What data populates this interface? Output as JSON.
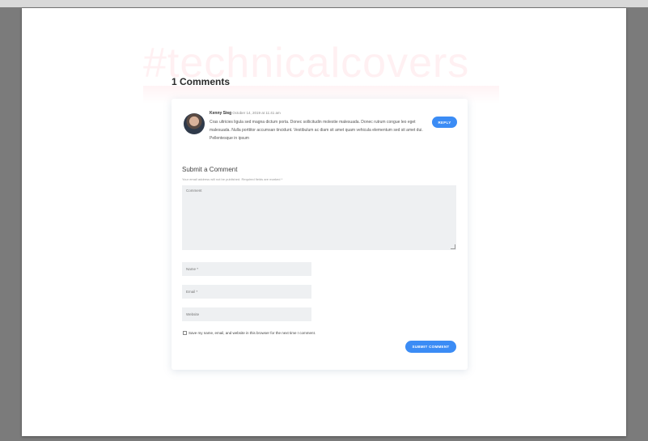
{
  "watermark": "#technicalcovers",
  "comments": {
    "heading": "1 Comments",
    "items": [
      {
        "author": "Kenny Sieg",
        "meta": "on October 14, 2019 at 11:41 am",
        "text": "Cras ultricies ligula sed magna dictum porta. Donec sollicitudin molestie malesuada. Donec rutrum congue leo eget malesuada. Nulla porttitor accumsan tincidunt. Vestibulum ac diam sit amet quam vehicula elementum sed sit amet dui. Pellentesque in ipsum",
        "reply_label": "REPLY"
      }
    ]
  },
  "form": {
    "title": "Submit a Comment",
    "notes": "Your email address will not be published. Required fields are marked *",
    "comment_placeholder": "Comment",
    "name_placeholder": "Name *",
    "email_placeholder": "Email *",
    "website_placeholder": "Website",
    "save_label": "Save my name, email, and website in this browser for the next time I comment.",
    "submit_label": "SUBMIT COMMENT"
  },
  "colors": {
    "accent": "#3b8cf5",
    "field_bg": "#eef0f2",
    "watermark": "#fff0f2"
  }
}
